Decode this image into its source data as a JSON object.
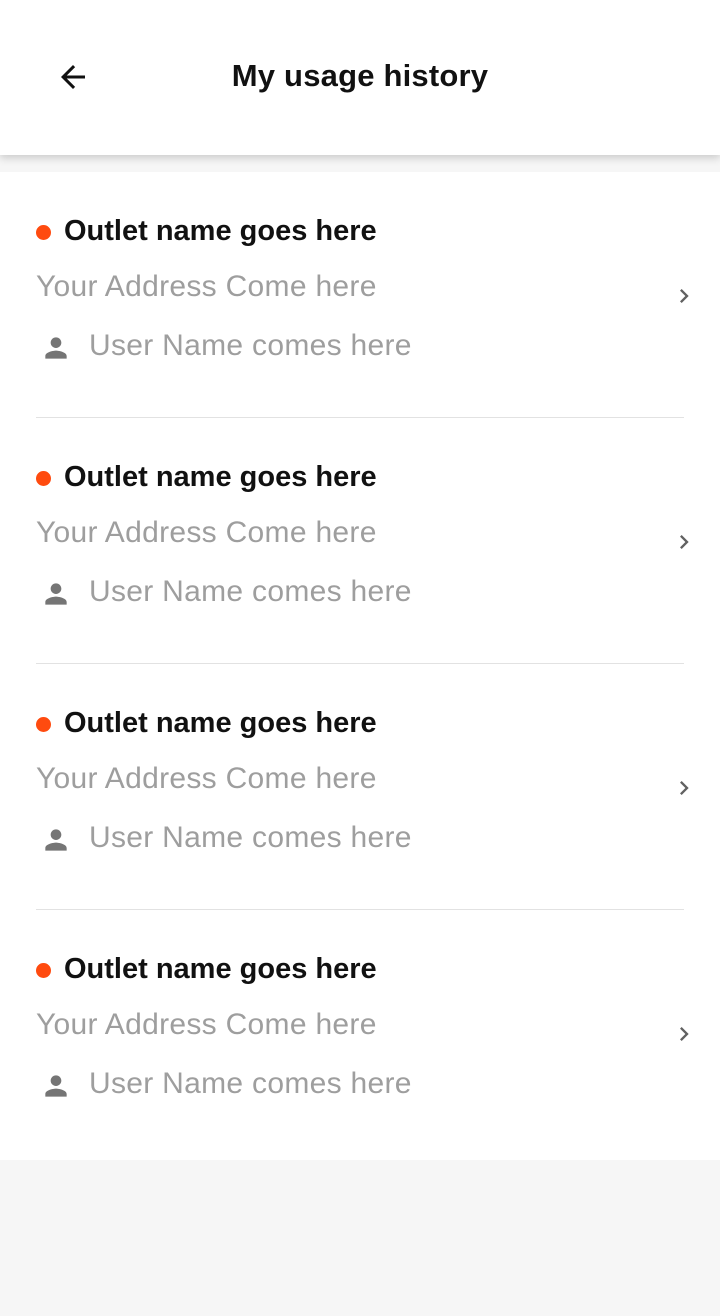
{
  "header": {
    "title": "My usage history",
    "back_icon": "arrow-left-icon"
  },
  "colors": {
    "accent": "#ff4b0f",
    "primary_text": "#111111",
    "secondary_text": "#9e9e9e",
    "icon": "#757575"
  },
  "history": {
    "items": [
      {
        "outlet_name": "Outlet name goes here",
        "address": "Your Address Come here",
        "user_name": "User Name comes here"
      },
      {
        "outlet_name": "Outlet name goes here",
        "address": "Your Address Come here",
        "user_name": "User Name comes here"
      },
      {
        "outlet_name": "Outlet name goes here",
        "address": "Your Address Come here",
        "user_name": "User Name comes here"
      },
      {
        "outlet_name": "Outlet name goes here",
        "address": "Your Address Come here",
        "user_name": "User Name comes here"
      }
    ]
  }
}
